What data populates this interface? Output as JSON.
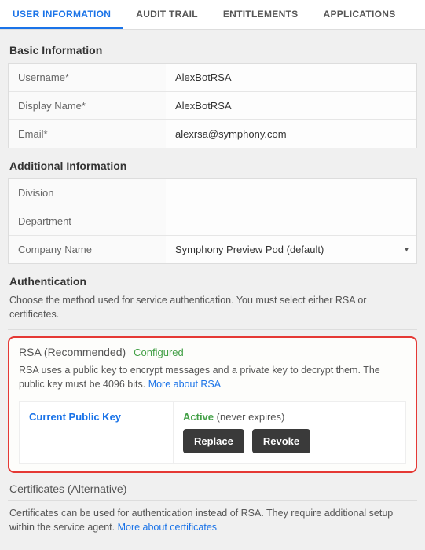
{
  "tabs": [
    {
      "label": "USER INFORMATION",
      "active": true
    },
    {
      "label": "AUDIT TRAIL",
      "active": false
    },
    {
      "label": "ENTITLEMENTS",
      "active": false
    },
    {
      "label": "APPLICATIONS",
      "active": false
    }
  ],
  "basic": {
    "title": "Basic Information",
    "rows": {
      "username": {
        "label": "Username*",
        "value": "AlexBotRSA"
      },
      "display_name": {
        "label": "Display Name*",
        "value": "AlexBotRSA"
      },
      "email": {
        "label": "Email*",
        "value": "alexrsa@symphony.com"
      }
    }
  },
  "additional": {
    "title": "Additional Information",
    "rows": {
      "division": {
        "label": "Division",
        "value": ""
      },
      "department": {
        "label": "Department",
        "value": ""
      },
      "company": {
        "label": "Company Name",
        "value": "Symphony Preview Pod (default)"
      }
    }
  },
  "auth": {
    "title": "Authentication",
    "desc": "Choose the method used for service authentication. You must select either RSA or certificates.",
    "rsa": {
      "title": "RSA (Recommended)",
      "status": "Configured",
      "desc": "RSA uses a public key to encrypt messages and a private key to decrypt them. The public key must be 4096 bits. ",
      "more_link": "More about RSA",
      "key": {
        "left_label": "Current Public Key",
        "active": "Active",
        "expires": "(never expires)",
        "replace": "Replace",
        "revoke": "Revoke"
      }
    },
    "cert": {
      "title": "Certificates (Alternative)",
      "desc": "Certificates can be used for authentication instead of RSA. They require additional setup within the service agent. ",
      "more_link": "More about certificates"
    }
  }
}
